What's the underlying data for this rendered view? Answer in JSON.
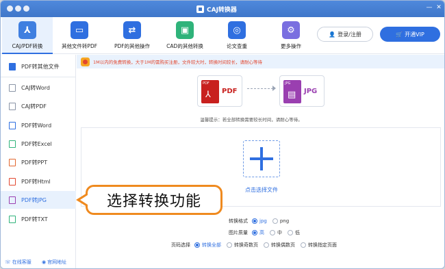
{
  "app": {
    "title": "CAJ转换器"
  },
  "toolbar": {
    "tools": [
      {
        "label": "CAJ/PDF转换",
        "icon": "caj-pdf-icon",
        "color": "#3f7fe0"
      },
      {
        "label": "其他文件转PDF",
        "icon": "folder-icon",
        "color": "#2f6fe0"
      },
      {
        "label": "PDF的其他操作",
        "icon": "swap-icon",
        "color": "#2f6fe0"
      },
      {
        "label": "CAD的其他转换",
        "icon": "cad-icon",
        "color": "#2fb37a"
      },
      {
        "label": "论文查重",
        "icon": "search-icon",
        "color": "#2f6fe0"
      },
      {
        "label": "更多操作",
        "icon": "gear-icon",
        "color": "#7a6fe0"
      }
    ],
    "login_label": "登录/注册",
    "vip_label": "开通VIP"
  },
  "sidebar": {
    "header": "PDF转其他文件",
    "items": [
      {
        "label": "CAJ转Word",
        "icon": "word-doc-icon"
      },
      {
        "label": "CAJ转PDF",
        "icon": "pdf-doc-icon"
      },
      {
        "label": "PDF转Word",
        "icon": "word-doc-icon"
      },
      {
        "label": "PDF转Excel",
        "icon": "excel-doc-icon"
      },
      {
        "label": "PDF转PPT",
        "icon": "ppt-doc-icon"
      },
      {
        "label": "PDF转Html",
        "icon": "html-doc-icon"
      },
      {
        "label": "PDF转JPG",
        "icon": "jpg-doc-icon"
      },
      {
        "label": "PDF转TXT",
        "icon": "txt-doc-icon"
      }
    ],
    "selected": "PDF转JPG",
    "footer_service": "在线客服",
    "footer_site": "官网地址"
  },
  "notice": {
    "text": "1M以内的免费转换，大于1M的需购买注册，文件较大时，转换时间较长，请耐心等待"
  },
  "conversion": {
    "from_label": "PDF",
    "from_tag": "PDF",
    "to_label": "JPG",
    "to_tag": "JPG",
    "tip": "温馨提示：若全部转换需要较长时间，请耐心等待。"
  },
  "dropzone": {
    "label": "点击选择文件"
  },
  "settings": {
    "format_label": "转换格式",
    "format_options": [
      "jpg",
      "png"
    ],
    "format_selected": "jpg",
    "quality_label": "图片质量",
    "quality_options": [
      "高",
      "中",
      "低"
    ],
    "quality_selected": "高",
    "pages_label": "页码选择",
    "pages_options": [
      "转换全部",
      "转换奇数页",
      "转换偶数页",
      "转换指定页面"
    ],
    "pages_selected": "转换全部"
  },
  "callout": {
    "text": "选择转换功能"
  },
  "colors": {
    "accent": "#2f6fe0",
    "callout_border": "#ef8a1f",
    "notice_text": "#e2472f",
    "pdf_red": "#c8201e",
    "jpg_purple": "#9a3fb0"
  }
}
